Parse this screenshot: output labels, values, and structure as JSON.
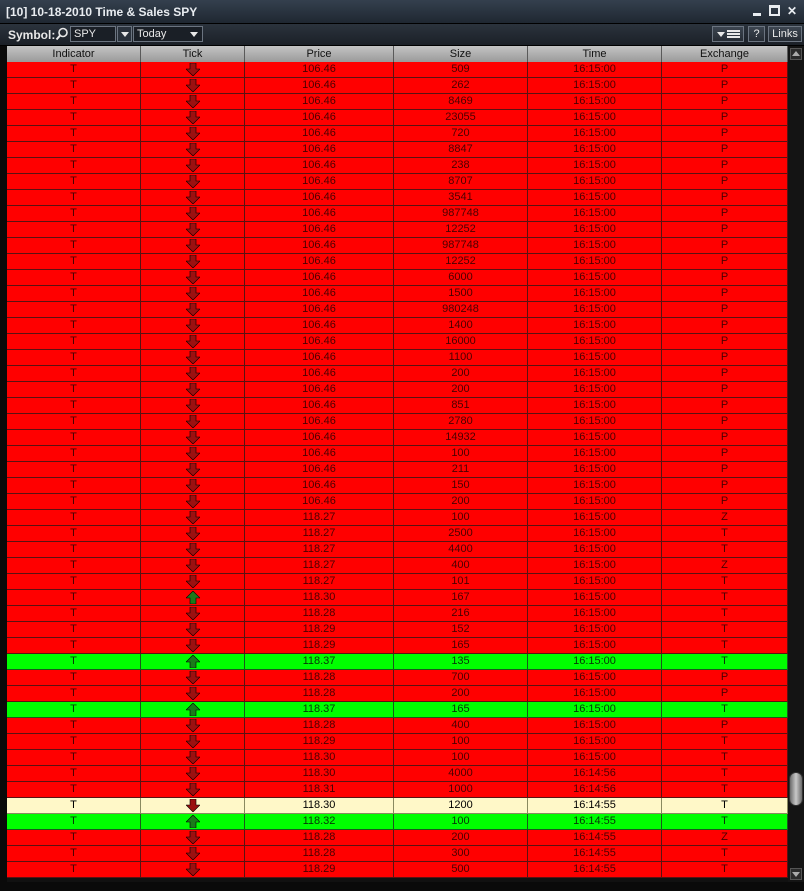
{
  "window": {
    "title": "[10] 10-18-2010 Time & Sales SPY"
  },
  "toolbar": {
    "symbol_label": "Symbol:",
    "symbol_value": "SPY",
    "range_value": "Today",
    "help_label": "?",
    "links_label": "Links"
  },
  "columns": [
    "Indicator",
    "Tick",
    "Price",
    "Size",
    "Time",
    "Exchange"
  ],
  "rows": [
    {
      "ind": "T",
      "tick": "down",
      "price": "106.46",
      "size": "509",
      "time": "16:15:00",
      "exch": "P"
    },
    {
      "ind": "T",
      "tick": "down",
      "price": "106.46",
      "size": "262",
      "time": "16:15:00",
      "exch": "P"
    },
    {
      "ind": "T",
      "tick": "down",
      "price": "106.46",
      "size": "8469",
      "time": "16:15:00",
      "exch": "P"
    },
    {
      "ind": "T",
      "tick": "down",
      "price": "106.46",
      "size": "23055",
      "time": "16:15:00",
      "exch": "P"
    },
    {
      "ind": "T",
      "tick": "down",
      "price": "106.46",
      "size": "720",
      "time": "16:15:00",
      "exch": "P"
    },
    {
      "ind": "T",
      "tick": "down",
      "price": "106.46",
      "size": "8847",
      "time": "16:15:00",
      "exch": "P"
    },
    {
      "ind": "T",
      "tick": "down",
      "price": "106.46",
      "size": "238",
      "time": "16:15:00",
      "exch": "P"
    },
    {
      "ind": "T",
      "tick": "down",
      "price": "106.46",
      "size": "8707",
      "time": "16:15:00",
      "exch": "P"
    },
    {
      "ind": "T",
      "tick": "down",
      "price": "106.46",
      "size": "3541",
      "time": "16:15:00",
      "exch": "P"
    },
    {
      "ind": "T",
      "tick": "down",
      "price": "106.46",
      "size": "987748",
      "time": "16:15:00",
      "exch": "P"
    },
    {
      "ind": "T",
      "tick": "down",
      "price": "106.46",
      "size": "12252",
      "time": "16:15:00",
      "exch": "P"
    },
    {
      "ind": "T",
      "tick": "down",
      "price": "106.46",
      "size": "987748",
      "time": "16:15:00",
      "exch": "P"
    },
    {
      "ind": "T",
      "tick": "down",
      "price": "106.46",
      "size": "12252",
      "time": "16:15:00",
      "exch": "P"
    },
    {
      "ind": "T",
      "tick": "down",
      "price": "106.46",
      "size": "6000",
      "time": "16:15:00",
      "exch": "P"
    },
    {
      "ind": "T",
      "tick": "down",
      "price": "106.46",
      "size": "1500",
      "time": "16:15:00",
      "exch": "P"
    },
    {
      "ind": "T",
      "tick": "down",
      "price": "106.46",
      "size": "980248",
      "time": "16:15:00",
      "exch": "P"
    },
    {
      "ind": "T",
      "tick": "down",
      "price": "106.46",
      "size": "1400",
      "time": "16:15:00",
      "exch": "P"
    },
    {
      "ind": "T",
      "tick": "down",
      "price": "106.46",
      "size": "16000",
      "time": "16:15:00",
      "exch": "P"
    },
    {
      "ind": "T",
      "tick": "down",
      "price": "106.46",
      "size": "1100",
      "time": "16:15:00",
      "exch": "P"
    },
    {
      "ind": "T",
      "tick": "down",
      "price": "106.46",
      "size": "200",
      "time": "16:15:00",
      "exch": "P"
    },
    {
      "ind": "T",
      "tick": "down",
      "price": "106.46",
      "size": "200",
      "time": "16:15:00",
      "exch": "P"
    },
    {
      "ind": "T",
      "tick": "down",
      "price": "106.46",
      "size": "851",
      "time": "16:15:00",
      "exch": "P"
    },
    {
      "ind": "T",
      "tick": "down",
      "price": "106.46",
      "size": "2780",
      "time": "16:15:00",
      "exch": "P"
    },
    {
      "ind": "T",
      "tick": "down",
      "price": "106.46",
      "size": "14932",
      "time": "16:15:00",
      "exch": "P"
    },
    {
      "ind": "T",
      "tick": "down",
      "price": "106.46",
      "size": "100",
      "time": "16:15:00",
      "exch": "P"
    },
    {
      "ind": "T",
      "tick": "down",
      "price": "106.46",
      "size": "211",
      "time": "16:15:00",
      "exch": "P"
    },
    {
      "ind": "T",
      "tick": "down",
      "price": "106.46",
      "size": "150",
      "time": "16:15:00",
      "exch": "P"
    },
    {
      "ind": "T",
      "tick": "down",
      "price": "106.46",
      "size": "200",
      "time": "16:15:00",
      "exch": "P"
    },
    {
      "ind": "T",
      "tick": "down",
      "price": "118.27",
      "size": "100",
      "time": "16:15:00",
      "exch": "Z"
    },
    {
      "ind": "T",
      "tick": "down",
      "price": "118.27",
      "size": "2500",
      "time": "16:15:00",
      "exch": "T"
    },
    {
      "ind": "T",
      "tick": "down",
      "price": "118.27",
      "size": "4400",
      "time": "16:15:00",
      "exch": "T"
    },
    {
      "ind": "T",
      "tick": "down",
      "price": "118.27",
      "size": "400",
      "time": "16:15:00",
      "exch": "Z"
    },
    {
      "ind": "T",
      "tick": "down",
      "price": "118.27",
      "size": "101",
      "time": "16:15:00",
      "exch": "T"
    },
    {
      "ind": "T",
      "tick": "up-green",
      "price": "118.30",
      "size": "167",
      "time": "16:15:00",
      "exch": "T"
    },
    {
      "ind": "T",
      "tick": "down",
      "price": "118.28",
      "size": "216",
      "time": "16:15:00",
      "exch": "T"
    },
    {
      "ind": "T",
      "tick": "down",
      "price": "118.29",
      "size": "152",
      "time": "16:15:00",
      "exch": "T"
    },
    {
      "ind": "T",
      "tick": "down",
      "price": "118.29",
      "size": "165",
      "time": "16:15:00",
      "exch": "T"
    },
    {
      "ind": "T",
      "tick": "up",
      "price": "118.37",
      "size": "135",
      "time": "16:15:00",
      "exch": "T"
    },
    {
      "ind": "T",
      "tick": "down",
      "price": "118.28",
      "size": "700",
      "time": "16:15:00",
      "exch": "P"
    },
    {
      "ind": "T",
      "tick": "down",
      "price": "118.28",
      "size": "200",
      "time": "16:15:00",
      "exch": "P"
    },
    {
      "ind": "T",
      "tick": "up",
      "price": "118.37",
      "size": "165",
      "time": "16:15:00",
      "exch": "T"
    },
    {
      "ind": "T",
      "tick": "down",
      "price": "118.28",
      "size": "400",
      "time": "16:15:00",
      "exch": "P"
    },
    {
      "ind": "T",
      "tick": "down",
      "price": "118.29",
      "size": "100",
      "time": "16:15:00",
      "exch": "T"
    },
    {
      "ind": "T",
      "tick": "down",
      "price": "118.30",
      "size": "100",
      "time": "16:15:00",
      "exch": "T"
    },
    {
      "ind": "T",
      "tick": "down",
      "price": "118.30",
      "size": "4000",
      "time": "16:14:56",
      "exch": "T"
    },
    {
      "ind": "T",
      "tick": "down",
      "price": "118.31",
      "size": "1000",
      "time": "16:14:56",
      "exch": "T"
    },
    {
      "ind": "T",
      "tick": "highlight",
      "price": "118.30",
      "size": "1200",
      "time": "16:14:55",
      "exch": "T"
    },
    {
      "ind": "T",
      "tick": "up",
      "price": "118.32",
      "size": "100",
      "time": "16:14:55",
      "exch": "T"
    },
    {
      "ind": "T",
      "tick": "down",
      "price": "118.28",
      "size": "200",
      "time": "16:14:55",
      "exch": "Z"
    },
    {
      "ind": "T",
      "tick": "down",
      "price": "118.28",
      "size": "300",
      "time": "16:14:55",
      "exch": "T"
    },
    {
      "ind": "T",
      "tick": "down",
      "price": "118.29",
      "size": "500",
      "time": "16:14:55",
      "exch": "T"
    }
  ],
  "colors": {
    "down_row": "#ff0000",
    "up_row": "#00ff00",
    "highlight_row": "#fff8c8",
    "down_arrow": "#9b1010",
    "up_arrow": "#1a7a1a"
  },
  "icons": {
    "search": "magnifier-icon",
    "tick_down": "arrow-down-icon",
    "tick_up": "arrow-up-icon"
  }
}
